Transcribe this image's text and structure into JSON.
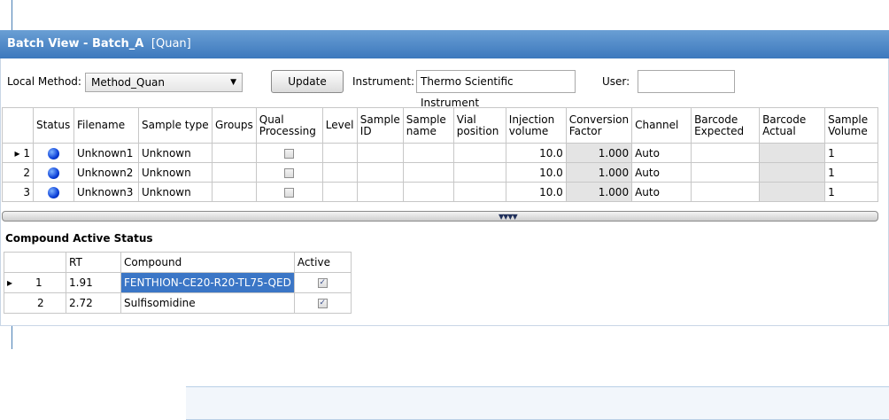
{
  "window": {
    "title": "Batch View - Batch_A",
    "mode": "[Quan]"
  },
  "toolbar": {
    "local_method_label": "Local Method:",
    "local_method_value": "Method_Quan",
    "update_label": "Update",
    "instrument_label": "Instrument:",
    "instrument_value": "Thermo Scientific Instrument",
    "user_label": "User:",
    "user_value": ""
  },
  "batch_grid": {
    "headers": [
      "",
      "Status",
      "Filename",
      "Sample type",
      "Groups",
      "Qual Processing",
      "Level",
      "Sample ID",
      "Sample name",
      "Vial position",
      "Injection volume",
      "Conversion Factor",
      "Channel",
      "Barcode Expected",
      "Barcode Actual",
      "Sample Volume"
    ],
    "rows": [
      {
        "index": "1",
        "current": true,
        "filename": "Unknown1",
        "sample_type": "Unknown",
        "groups": "",
        "qual": false,
        "level": "",
        "sample_id": "",
        "sample_name": "",
        "vial": "",
        "injection": "10.0",
        "conversion": "1.000",
        "channel": "Auto",
        "barcode_expected": "",
        "barcode_actual": "",
        "sample_volume": "1"
      },
      {
        "index": "2",
        "current": false,
        "filename": "Unknown2",
        "sample_type": "Unknown",
        "groups": "",
        "qual": false,
        "level": "",
        "sample_id": "",
        "sample_name": "",
        "vial": "",
        "injection": "10.0",
        "conversion": "1.000",
        "channel": "Auto",
        "barcode_expected": "",
        "barcode_actual": "",
        "sample_volume": "1"
      },
      {
        "index": "3",
        "current": false,
        "filename": "Unknown3",
        "sample_type": "Unknown",
        "groups": "",
        "qual": false,
        "level": "",
        "sample_id": "",
        "sample_name": "",
        "vial": "",
        "injection": "10.0",
        "conversion": "1.000",
        "channel": "Auto",
        "barcode_expected": "",
        "barcode_actual": "",
        "sample_volume": "1"
      }
    ]
  },
  "compound_section": {
    "title": "Compound Active Status",
    "headers": [
      "",
      "RT",
      "Compound",
      "Active"
    ],
    "rows": [
      {
        "index": "1",
        "current": true,
        "rt": "1.91",
        "compound": "FENTHION-CE20-R20-TL75-QED",
        "active": true
      },
      {
        "index": "2",
        "current": false,
        "rt": "2.72",
        "compound": "Sulfisomidine",
        "active": true
      }
    ]
  },
  "colors": {
    "title_bar": "#3c78bd",
    "selection": "#3b76c6",
    "callout": "#4a7fb5",
    "status_dot": "#0b3fd8"
  },
  "icons": {
    "status": "blue-circle-status-icon",
    "row_pointer": "row-pointer-arrow-icon",
    "dropdown": "chevron-down-icon",
    "splitter": "splitter-grip-icon"
  }
}
